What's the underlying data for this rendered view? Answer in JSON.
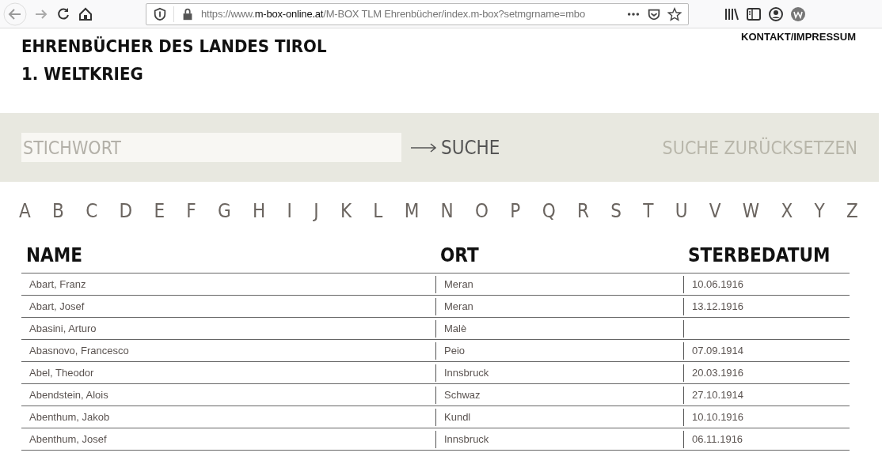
{
  "browser": {
    "url_prefix": "https://www.",
    "url_domain": "m-box-online.at",
    "url_rest": "/M-BOX TLM Ehrenbücher/index.m-box?setmgrname=mbo"
  },
  "header": {
    "title_lines": [
      "EHRENBÜCHER DES LANDES TIROL",
      "1. WELTKRIEG"
    ],
    "contact_link": "KONTAKT/IMPRESSUM"
  },
  "search": {
    "placeholder": "STICHWORT",
    "button": "SUCHE",
    "reset": "SUCHE ZURÜCKSETZEN"
  },
  "alphabet": [
    "A",
    "B",
    "C",
    "D",
    "E",
    "F",
    "G",
    "H",
    "I",
    "J",
    "K",
    "L",
    "M",
    "N",
    "O",
    "P",
    "Q",
    "R",
    "S",
    "T",
    "U",
    "V",
    "W",
    "X",
    "Y",
    "Z"
  ],
  "table": {
    "columns": [
      "NAME",
      "ORT",
      "STERBEDATUM"
    ],
    "rows": [
      {
        "name": "Abart, Franz",
        "ort": "Meran",
        "date": "10.06.1916"
      },
      {
        "name": "Abart, Josef",
        "ort": "Meran",
        "date": "13.12.1916"
      },
      {
        "name": "Abasini, Arturo",
        "ort": "Malè"
      },
      {
        "name": "Abasnovo, Francesco",
        "ort": "Peio",
        "date": "07.09.1914"
      },
      {
        "name": "Abel, Theodor",
        "ort": "Innsbruck",
        "date": "20.03.1916"
      },
      {
        "name": "Abendstein, Alois",
        "ort": "Schwaz",
        "date": "27.10.1914"
      },
      {
        "name": "Abenthum, Jakob",
        "ort": "Kundl",
        "date": "10.10.1916"
      },
      {
        "name": "Abenthum, Josef",
        "ort": "Innsbruck",
        "date": "06.11.1916"
      }
    ]
  }
}
